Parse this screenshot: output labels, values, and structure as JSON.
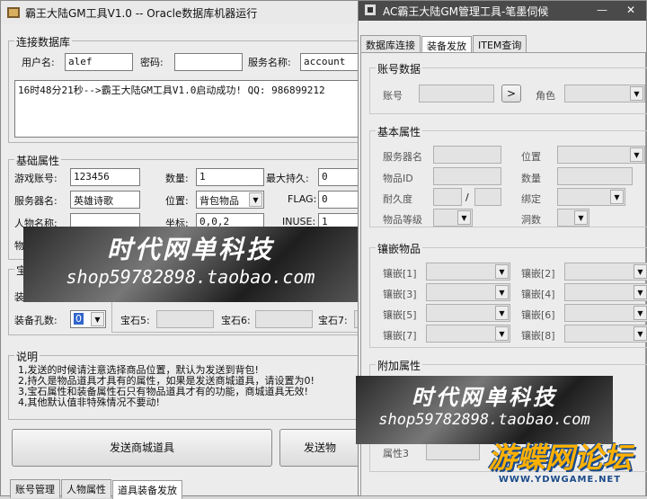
{
  "left_window": {
    "title": "霸王大陆GM工具V1.0  -- Oracle数据库机器运行",
    "db_group": {
      "title": "连接数据库",
      "user_label": "用户名:",
      "user_value": "alef",
      "password_label": "密码:",
      "password_value": "",
      "service_label": "服务名称:",
      "service_value": "account",
      "log_text": "16时48分21秒-->霸王大陆GM工具V1.0启动成功!  QQ: 986899212"
    },
    "basic_group": {
      "title": "基础属性",
      "account_label": "游戏账号:",
      "account_value": "123456",
      "count_label": "数量:",
      "count_value": "1",
      "maxdur_label": "最大持久:",
      "maxdur_value": "0",
      "server_label": "服务器名:",
      "server_value": "英雄诗歌",
      "position_label": "位置:",
      "position_value": "背包物品",
      "flag_label": "FLAG:",
      "flag_value": "0",
      "char_label": "人物名称:",
      "char_value": "",
      "coord_label": "坐标:",
      "coord_value": "0,0,2",
      "inuse_label": "INUSE:",
      "inuse_value": "1",
      "item_label": "物"
    },
    "gem_group": {
      "title": "宝",
      "equip_label": "装",
      "holes_label": "装备孔数:",
      "holes_value": "0",
      "gem5_label": "宝石5:",
      "gem6_label": "宝石6:",
      "gem7_label": "宝石7:"
    },
    "notes_group": {
      "title": "说明",
      "lines": [
        "1,发送的时候请注意选择商品位置，默认为发送到背包!",
        "2,持久是物品道具才具有的属性，如果是发送商城道具，请设置为0!",
        "3,宝石属性和装备属性石只有物品道具才有的功能，商城道具无效!",
        "4,其他默认值非特殊情况不要动!"
      ]
    },
    "send_mall_button": "发送商城道具",
    "send_other_button": "发送物",
    "tabs": [
      "账号管理",
      "人物属性",
      "道具装备发放"
    ]
  },
  "right_window": {
    "title": "AC霸王大陆GM管理工具-笔墨伺候",
    "tabs": [
      "数据库连接",
      "装备发放",
      "ITEM查询"
    ],
    "account_group": {
      "title": "账号数据",
      "account_label": "账号",
      "go_button": ">",
      "role_label": "角色"
    },
    "basic_group": {
      "title": "基本属性",
      "server_label": "服务器名",
      "position_label": "位置",
      "item_id_label": "物品ID",
      "count_label": "数量",
      "dur_label": "耐久度",
      "dur_sep": "/",
      "bind_label": "绑定",
      "level_label": "物品等级",
      "holes_label": "洞数"
    },
    "inlay_group": {
      "title": "镶嵌物品",
      "slots": [
        "镶嵌[1]",
        "镶嵌[2]",
        "镶嵌[3]",
        "镶嵌[4]",
        "镶嵌[5]",
        "镶嵌[6]",
        "镶嵌[7]",
        "镶嵌[8]"
      ]
    },
    "attr_group": {
      "title": "附加属性",
      "attr3_label": "属性3"
    }
  },
  "watermarks": [
    {
      "line1": "时代网单科技",
      "line2": "shop59782898.taobao.com"
    },
    {
      "line1": "时代网单科技",
      "line2": "shop59782898.taobao.com"
    }
  ],
  "forum_logo": {
    "text": "游蝶网论坛",
    "url": "WWW.YDWGAME.NET"
  }
}
